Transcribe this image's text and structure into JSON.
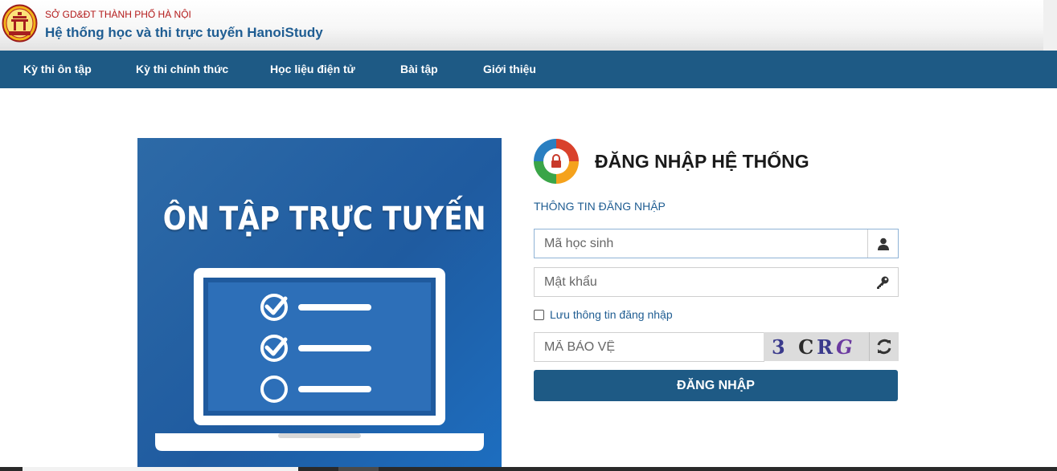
{
  "header": {
    "org_name": "SỞ GD&ĐT THÀNH PHỐ HÀ NỘI",
    "system_name": "Hệ thống học và thi trực tuyến HanoiStudy",
    "logo_icon": "hanoi-emblem-icon"
  },
  "nav": {
    "items": [
      {
        "label": "Kỳ thi ôn tập"
      },
      {
        "label": "Kỳ thi chính thức"
      },
      {
        "label": "Học liệu điện tử"
      },
      {
        "label": "Bài tập"
      },
      {
        "label": "Giới thiệu"
      }
    ]
  },
  "banner": {
    "title": "ÔN TẬP TRỰC TUYẾN",
    "illustration": "laptop-checklist-icon"
  },
  "login": {
    "title": "ĐĂNG NHẬP HỆ THỐNG",
    "section_label": "THÔNG TIN ĐĂNG NHẬP",
    "student_id": {
      "placeholder": "Mã học sinh",
      "value": "",
      "icon": "user-icon"
    },
    "password": {
      "placeholder": "Mật khẩu",
      "value": "",
      "icon": "key-icon"
    },
    "remember": {
      "label": "Lưu thông tin đăng nhập",
      "checked": false
    },
    "captcha": {
      "placeholder": "MÃ BẢO VỆ",
      "value": "",
      "image_text": "3CRG",
      "refresh_icon": "refresh-icon"
    },
    "submit_label": "ĐĂNG NHẬP"
  },
  "colors": {
    "nav_bg": "#1e5a85",
    "accent_blue": "#1f5d92",
    "org_red": "#b31a1a",
    "banner_blue": "#1f5ba0"
  }
}
